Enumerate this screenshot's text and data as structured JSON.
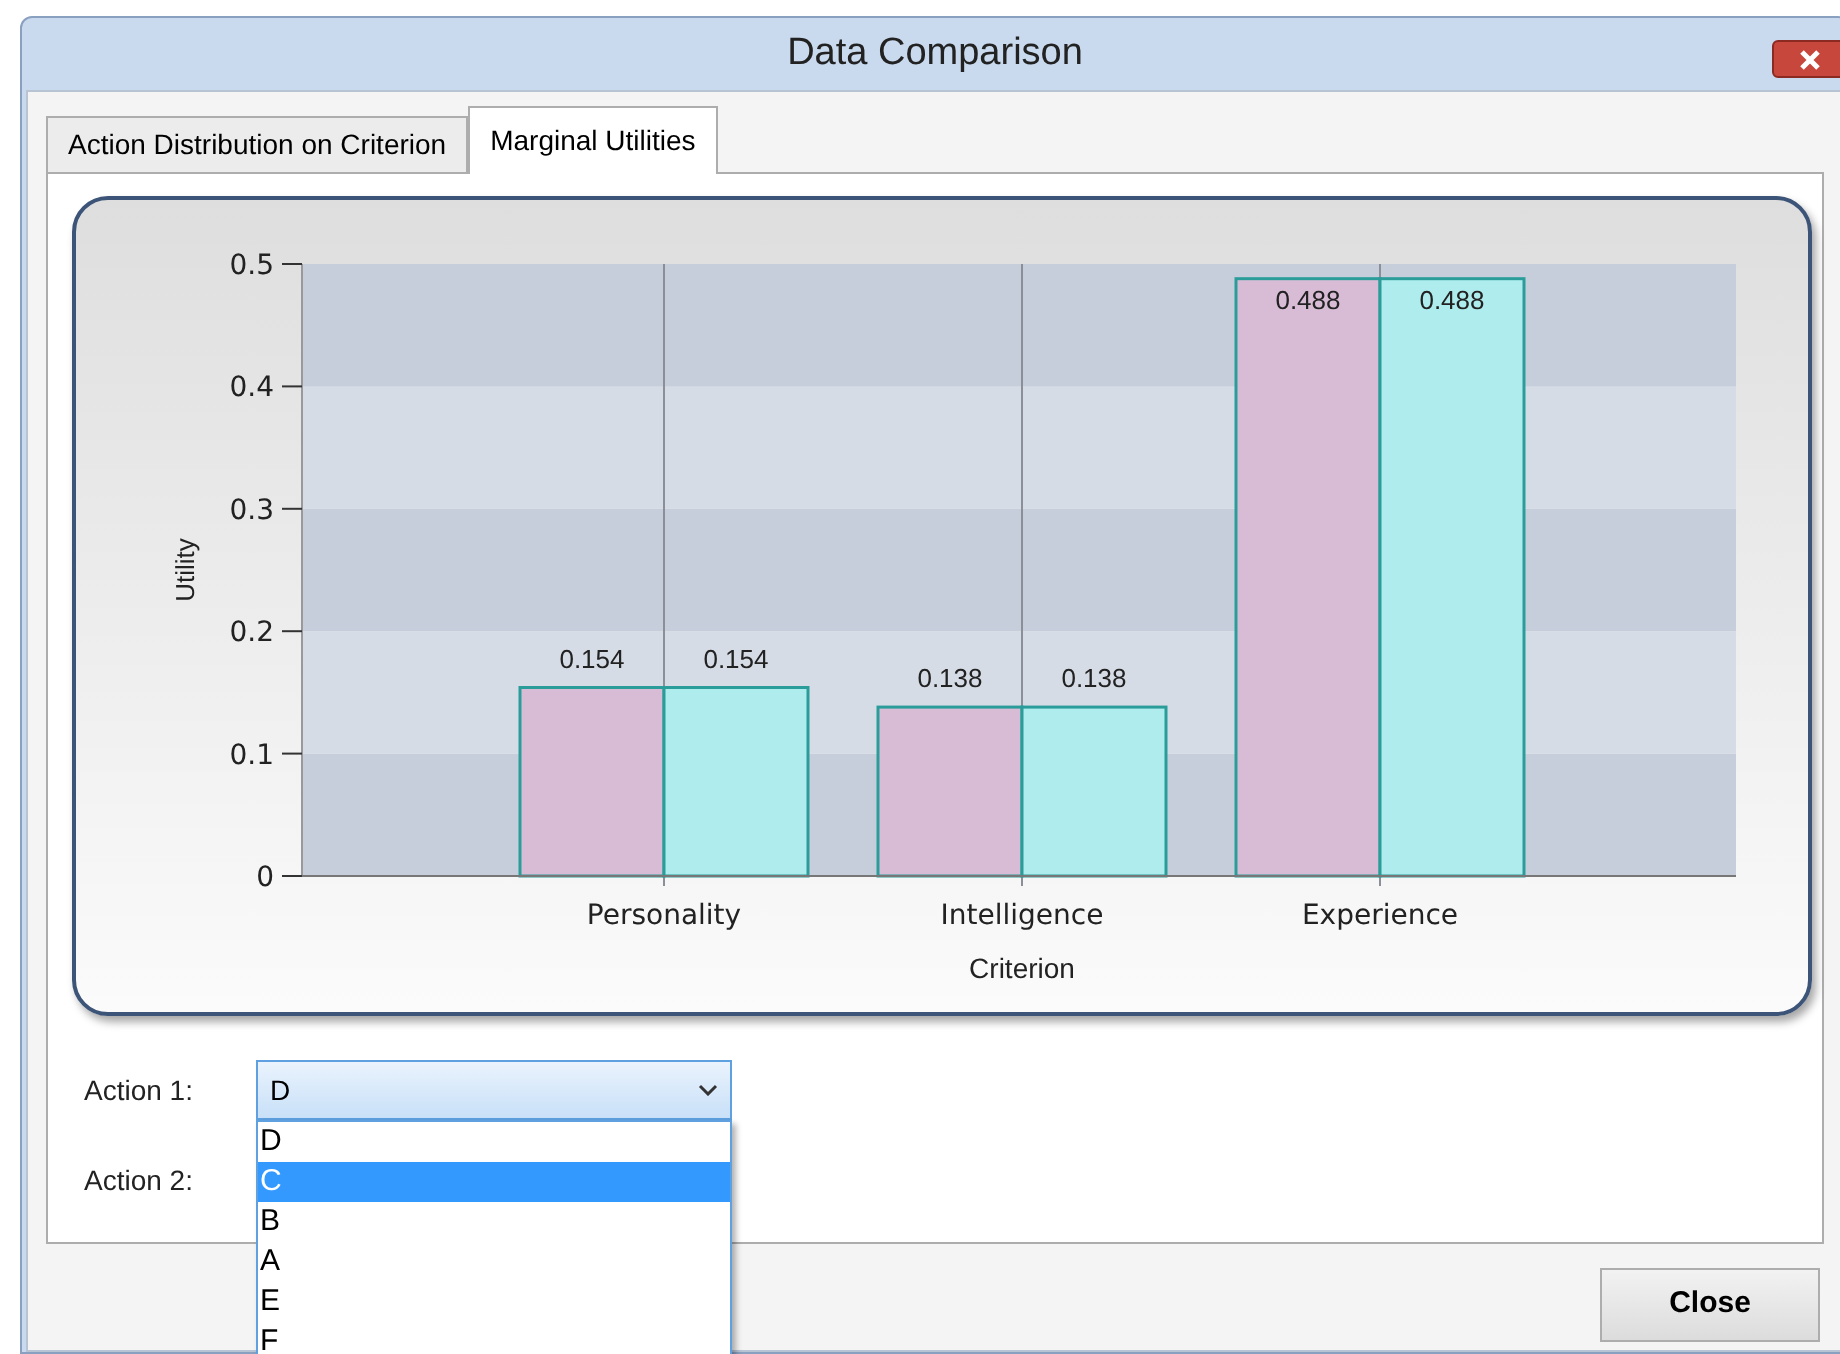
{
  "window": {
    "title": "Data Comparison"
  },
  "tabs": [
    {
      "label": "Action Distribution on Criterion",
      "selected": false
    },
    {
      "label": "Marginal Utilities",
      "selected": true
    }
  ],
  "chart_data": {
    "type": "bar",
    "xlabel": "Criterion",
    "ylabel": "Utility",
    "categories": [
      "Personality",
      "Intelligence",
      "Experience"
    ],
    "series": [
      {
        "color": "#d8bcd6",
        "values": [
          0.154,
          0.138,
          0.488
        ]
      },
      {
        "color": "#aeeced",
        "values": [
          0.154,
          0.138,
          0.488
        ]
      }
    ],
    "grid": true,
    "ylim": [
      0,
      0.5
    ],
    "yticks": [
      0,
      0.1,
      0.2,
      0.3,
      0.4,
      0.5
    ],
    "value_labels": [
      "0.154",
      "0.138",
      "0.488"
    ],
    "data_labels": true
  },
  "action1": {
    "label": "Action 1:",
    "value": "D",
    "options": [
      {
        "label": "D",
        "highlighted": false
      },
      {
        "label": "C",
        "highlighted": true
      },
      {
        "label": "B",
        "highlighted": false
      },
      {
        "label": "A",
        "highlighted": false
      },
      {
        "label": "E",
        "highlighted": false
      },
      {
        "label": "F",
        "highlighted": false
      }
    ]
  },
  "action2": {
    "label": "Action 2:"
  },
  "close_button": "Close"
}
